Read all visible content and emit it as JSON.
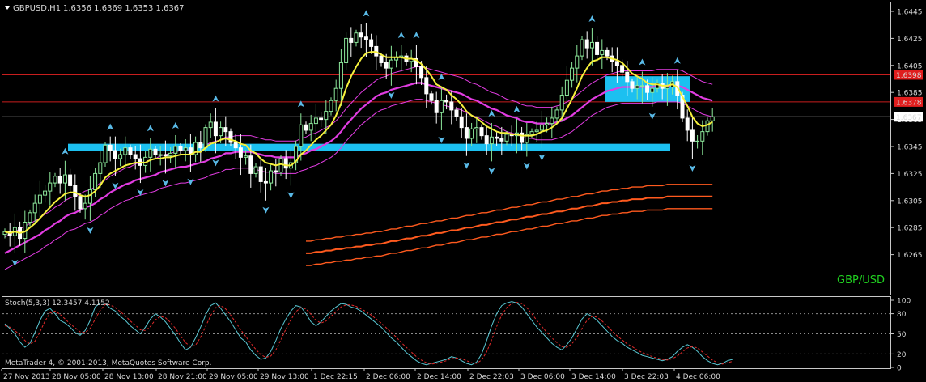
{
  "header": {
    "menu_icon": "triangle-down-icon",
    "symbol_tf": "GBPUSD,H1",
    "ohlc": "1.6356 1.6369 1.6353 1.6367",
    "watermark": "GBP/USD",
    "copyright": "MetaTrader 4, © 2001-2013, MetaQuotes Software Corp."
  },
  "colors": {
    "background": "#000000",
    "bull": "#8ce89b",
    "bear": "#ffffff",
    "ma_fast": "#f5f03c",
    "ma_mid": "#e23ce2",
    "ma_slow": "#ff5a1e",
    "zone": "#1cc0f0",
    "hline": "#c81e1e",
    "arrow": "#59b9e6",
    "stoch_main": "#59c6d2",
    "stoch_signal": "#e02a2a",
    "watermark": "#20d020"
  },
  "price_labels": [
    {
      "text": "1.6398",
      "price": 1.6398
    },
    {
      "text": "1.6378",
      "price": 1.6378
    },
    {
      "text": "1.6367",
      "price": 1.6367
    }
  ],
  "stoch": {
    "label": "Stoch(5,3,3) 12.3457 4.1152",
    "ticks": [
      "100",
      "80",
      "50",
      "20",
      "0"
    ]
  },
  "chart_data": {
    "type": "candlestick",
    "symbol": "GBPUSD",
    "timeframe": "H1",
    "ylim": [
      1.6257,
      1.6454
    ],
    "y_ticks": [
      1.6445,
      1.6425,
      1.6405,
      1.6385,
      1.6365,
      1.6345,
      1.6325,
      1.6305,
      1.6285,
      1.6265
    ],
    "x_ticks": [
      "27 Nov 2013",
      "28 Nov 05:00",
      "28 Nov 13:00",
      "28 Nov 21:00",
      "29 Nov 05:00",
      "29 Nov 13:00",
      "1 Dec 22:15",
      "2 Dec 06:00",
      "2 Dec 14:00",
      "2 Dec 22:03",
      "3 Dec 06:00",
      "3 Dec 14:00",
      "3 Dec 22:03",
      "4 Dec 06:00"
    ],
    "horizontal_lines": [
      1.6398,
      1.6378,
      1.6367
    ],
    "support_zone": {
      "price_low": 1.6342,
      "price_high": 1.6347
    },
    "resistance_zone": {
      "price_low": 1.6378,
      "price_high": 1.6397
    },
    "closes": [
      1.6282,
      1.6279,
      1.6285,
      1.6277,
      1.6289,
      1.6296,
      1.6303,
      1.6309,
      1.6312,
      1.6318,
      1.6323,
      1.6318,
      1.6324,
      1.6316,
      1.6308,
      1.6299,
      1.6303,
      1.6313,
      1.6325,
      1.6333,
      1.6346,
      1.6342,
      1.6336,
      1.6339,
      1.6344,
      1.6339,
      1.6336,
      1.6331,
      1.6337,
      1.6343,
      1.6339,
      1.6339,
      1.6338,
      1.634,
      1.6345,
      1.6342,
      1.6344,
      1.6339,
      1.6348,
      1.6344,
      1.6359,
      1.6363,
      1.6353,
      1.6359,
      1.6356,
      1.6348,
      1.6344,
      1.6337,
      1.6338,
      1.6325,
      1.633,
      1.6319,
      1.6318,
      1.6327,
      1.6326,
      1.6336,
      1.6329,
      1.6333,
      1.6345,
      1.6361,
      1.6357,
      1.6362,
      1.6366,
      1.6365,
      1.6371,
      1.6379,
      1.6388,
      1.6407,
      1.6425,
      1.6422,
      1.6429,
      1.6426,
      1.6424,
      1.6419,
      1.6412,
      1.6407,
      1.6403,
      1.6409,
      1.6411,
      1.6412,
      1.6408,
      1.641,
      1.6404,
      1.6396,
      1.6384,
      1.6379,
      1.637,
      1.6379,
      1.6378,
      1.6372,
      1.6367,
      1.6359,
      1.6351,
      1.6358,
      1.6359,
      1.6353,
      1.6347,
      1.6352,
      1.6351,
      1.6349,
      1.6354,
      1.6353,
      1.6355,
      1.6348,
      1.6354,
      1.6356,
      1.6357,
      1.6361,
      1.6362,
      1.6366,
      1.6372,
      1.6383,
      1.6394,
      1.6403,
      1.6412,
      1.6424,
      1.6418,
      1.6422,
      1.6413,
      1.6416,
      1.6412,
      1.6408,
      1.6405,
      1.64,
      1.6393,
      1.6388,
      1.639,
      1.639,
      1.6385,
      1.6388,
      1.6392,
      1.6388,
      1.6389,
      1.6393,
      1.6383,
      1.6366,
      1.6357,
      1.6349,
      1.6349,
      1.6356,
      1.6364,
      1.6367
    ],
    "ma_fast": [
      1.6282,
      1.6281,
      1.6282,
      1.6281,
      1.6282,
      1.6285,
      1.6288,
      1.6292,
      1.6296,
      1.63,
      1.6304,
      1.6307,
      1.631,
      1.6311,
      1.6311,
      1.6309,
      1.6308,
      1.6309,
      1.6312,
      1.6316,
      1.6322,
      1.6325,
      1.6327,
      1.6329,
      1.6331,
      1.6332,
      1.6333,
      1.6333,
      1.6333,
      1.6335,
      1.6336,
      1.6336,
      1.6337,
      1.6337,
      1.6338,
      1.6339,
      1.6339,
      1.6339,
      1.6341,
      1.6341,
      1.6344,
      1.6347,
      1.6348,
      1.635,
      1.6351,
      1.635,
      1.6349,
      1.6347,
      1.6346,
      1.6342,
      1.634,
      1.6336,
      1.6333,
      1.6332,
      1.6331,
      1.6332,
      1.6331,
      1.6331,
      1.6334,
      1.6339,
      1.6342,
      1.6346,
      1.635,
      1.6353,
      1.6357,
      1.6361,
      1.6368,
      1.6377,
      1.6388,
      1.6397,
      1.6404,
      1.641,
      1.6414,
      1.6415,
      1.6415,
      1.6413,
      1.6411,
      1.6411,
      1.6411,
      1.6411,
      1.641,
      1.641,
      1.6409,
      1.6406,
      1.6402,
      1.6397,
      1.6391,
      1.6389,
      1.6387,
      1.6383,
      1.638,
      1.6376,
      1.6371,
      1.6368,
      1.6366,
      1.6363,
      1.636,
      1.6358,
      1.6356,
      1.6355,
      1.6355,
      1.6354,
      1.6354,
      1.6353,
      1.6353,
      1.6353,
      1.6354,
      1.6356,
      1.6357,
      1.6359,
      1.6362,
      1.6366,
      1.6373,
      1.638,
      1.6388,
      1.6397,
      1.6403,
      1.6408,
      1.6409,
      1.6411,
      1.6411,
      1.641,
      1.6409,
      1.6407,
      1.6403,
      1.6399,
      1.6397,
      1.6395,
      1.6392,
      1.6391,
      1.6391,
      1.639,
      1.639,
      1.6391,
      1.6389,
      1.6382,
      1.6375,
      1.6367,
      1.6362,
      1.636,
      1.6361,
      1.6363
    ],
    "ma_mid": [
      1.6266,
      1.6268,
      1.627,
      1.6272,
      1.6274,
      1.6276,
      1.6278,
      1.628,
      1.6283,
      1.6285,
      1.6288,
      1.629,
      1.6293,
      1.6295,
      1.6296,
      1.6298,
      1.63,
      1.6301,
      1.6303,
      1.6306,
      1.6308,
      1.6311,
      1.6313,
      1.6315,
      1.6317,
      1.6318,
      1.632,
      1.6321,
      1.6322,
      1.6323,
      1.6324,
      1.6326,
      1.6327,
      1.6328,
      1.6329,
      1.633,
      1.633,
      1.6331,
      1.6332,
      1.6333,
      1.6334,
      1.6336,
      1.6337,
      1.6338,
      1.634,
      1.634,
      1.6341,
      1.6341,
      1.6341,
      1.6341,
      1.634,
      1.6339,
      1.6338,
      1.6338,
      1.6337,
      1.6337,
      1.6337,
      1.6337,
      1.6337,
      1.6339,
      1.634,
      1.6342,
      1.6343,
      1.6345,
      1.6347,
      1.6349,
      1.6352,
      1.6356,
      1.6361,
      1.6365,
      1.6369,
      1.6373,
      1.6376,
      1.6379,
      1.6382,
      1.6384,
      1.6385,
      1.6387,
      1.6388,
      1.6389,
      1.639,
      1.6391,
      1.6392,
      1.6392,
      1.6391,
      1.639,
      1.6389,
      1.6388,
      1.6387,
      1.6386,
      1.6385,
      1.6384,
      1.6382,
      1.638,
      1.6379,
      1.6377,
      1.6375,
      1.6373,
      1.6372,
      1.637,
      1.6368,
      1.6367,
      1.6366,
      1.6364,
      1.6363,
      1.6363,
      1.6362,
      1.6362,
      1.6362,
      1.6362,
      1.6363,
      1.6364,
      1.6366,
      1.6368,
      1.6371,
      1.6374,
      1.6377,
      1.638,
      1.6382,
      1.6384,
      1.6386,
      1.6387,
      1.6388,
      1.6389,
      1.6389,
      1.6389,
      1.6389,
      1.6389,
      1.6389,
      1.6389,
      1.639,
      1.639,
      1.639,
      1.639,
      1.639,
      1.6389,
      1.6387,
      1.6385,
      1.6383,
      1.6381,
      1.638,
      1.6379
    ],
    "ma_slow_visible_from_index": 60,
    "ma_slow": [
      1.6266,
      1.6266,
      1.6267,
      1.6267,
      1.6268,
      1.6268,
      1.6269,
      1.6269,
      1.627,
      1.627,
      1.6271,
      1.6271,
      1.6272,
      1.6272,
      1.6273,
      1.6273,
      1.6274,
      1.6275,
      1.6275,
      1.6276,
      1.6277,
      1.6277,
      1.6278,
      1.6279,
      1.6279,
      1.628,
      1.6281,
      1.6281,
      1.6282,
      1.6283,
      1.6283,
      1.6284,
      1.6285,
      1.6285,
      1.6286,
      1.6287,
      1.6287,
      1.6288,
      1.6289,
      1.6289,
      1.629,
      1.6291,
      1.6291,
      1.6292,
      1.6293,
      1.6293,
      1.6294,
      1.6295,
      1.6295,
      1.6296,
      1.6297,
      1.6297,
      1.6298,
      1.6299,
      1.6299,
      1.63,
      1.6301,
      1.6301,
      1.6302,
      1.6303,
      1.6303,
      1.6304,
      1.6304,
      1.6305,
      1.6305,
      1.6306,
      1.6306,
      1.6306,
      1.6307,
      1.6307,
      1.6307,
      1.6307,
      1.6308,
      1.6308,
      1.6308,
      1.6308,
      1.6308,
      1.6308,
      1.6308,
      1.6308,
      1.6308,
      1.6308
    ],
    "stoch_main": [
      65,
      58,
      50,
      38,
      30,
      36,
      52,
      70,
      84,
      88,
      80,
      70,
      66,
      60,
      52,
      48,
      55,
      70,
      90,
      96,
      95,
      88,
      84,
      76,
      70,
      62,
      56,
      50,
      60,
      72,
      80,
      75,
      68,
      58,
      48,
      36,
      26,
      30,
      44,
      60,
      78,
      92,
      96,
      88,
      78,
      68,
      56,
      44,
      38,
      26,
      18,
      12,
      14,
      24,
      40,
      58,
      72,
      84,
      92,
      90,
      80,
      68,
      62,
      68,
      76,
      84,
      90,
      95,
      94,
      90,
      88,
      84,
      78,
      72,
      66,
      60,
      52,
      44,
      38,
      30,
      22,
      16,
      10,
      6,
      4,
      6,
      8,
      10,
      12,
      16,
      14,
      10,
      6,
      4,
      8,
      20,
      40,
      62,
      80,
      92,
      96,
      98,
      96,
      90,
      80,
      70,
      60,
      52,
      44,
      36,
      30,
      26,
      34,
      44,
      58,
      72,
      80,
      76,
      70,
      62,
      54,
      46,
      40,
      36,
      30,
      26,
      22,
      18,
      16,
      14,
      12,
      10,
      12,
      16,
      24,
      30,
      34,
      30,
      24,
      16,
      10,
      6,
      4,
      6,
      10,
      12
    ],
    "stoch_signal": [
      62,
      60,
      55,
      48,
      40,
      35,
      39,
      53,
      69,
      81,
      84,
      79,
      72,
      65,
      59,
      53,
      52,
      58,
      72,
      85,
      94,
      93,
      89,
      83,
      77,
      69,
      63,
      56,
      55,
      61,
      71,
      76,
      74,
      67,
      58,
      47,
      37,
      31,
      33,
      45,
      61,
      77,
      89,
      92,
      87,
      78,
      67,
      56,
      46,
      36,
      27,
      19,
      15,
      17,
      26,
      41,
      57,
      71,
      83,
      89,
      87,
      79,
      70,
      66,
      69,
      76,
      83,
      90,
      93,
      93,
      91,
      87,
      83,
      78,
      72,
      66,
      59,
      52,
      45,
      37,
      30,
      23,
      16,
      11,
      7,
      5,
      6,
      8,
      10,
      13,
      14,
      13,
      10,
      7,
      6,
      11,
      23,
      41,
      61,
      78,
      89,
      95,
      97,
      95,
      89,
      80,
      70,
      61,
      52,
      44,
      37,
      31,
      30,
      35,
      45,
      58,
      70,
      76,
      75,
      69,
      62,
      54,
      47,
      41,
      35,
      31,
      26,
      22,
      19,
      16,
      14,
      12,
      11,
      13,
      17,
      23,
      29,
      31,
      29,
      23,
      17,
      11,
      7,
      5,
      7,
      9
    ]
  }
}
